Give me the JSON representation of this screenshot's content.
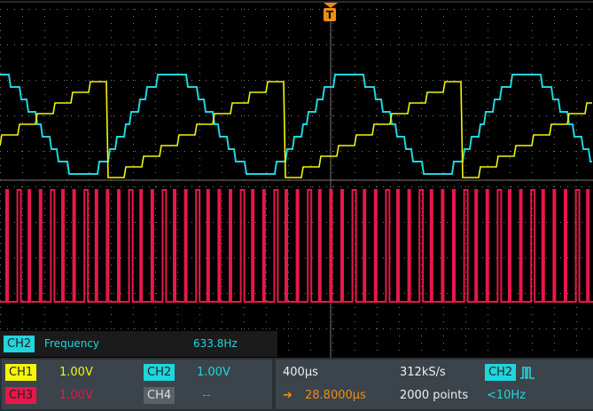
{
  "colors": {
    "ch1": "#f5f50a",
    "ch2": "#1ed6dc",
    "ch3": "#e8174a",
    "ch4": "#5a6268",
    "trigger": "#f08c14",
    "grid": "#777777"
  },
  "trigger": {
    "marker_label": "T"
  },
  "measurement": {
    "channel": "CH2",
    "name": "Frequency",
    "value": "633.8Hz"
  },
  "channels": [
    {
      "label": "CH1",
      "scale": "1.00V"
    },
    {
      "label": "CH2",
      "scale": "1.00V"
    },
    {
      "label": "CH3",
      "scale": "1.00V"
    },
    {
      "label": "CH4",
      "scale": "--"
    }
  ],
  "horizontal": {
    "timebase": "400µs",
    "sample_rate": "312kS/s",
    "delay": "28.8000µs",
    "record_length": "2000 points"
  },
  "trigger_info": {
    "source": "CH2",
    "frequency": "<10Hz"
  }
}
